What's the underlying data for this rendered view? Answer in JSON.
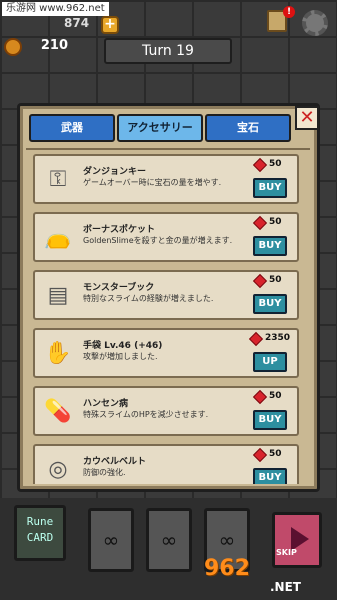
{
  "watermark": "乐游网 www.962.net",
  "header": {
    "hearts": "874",
    "coins": "210",
    "turn_label": "Turn 19"
  },
  "tabs": [
    {
      "label": "武器",
      "active": false
    },
    {
      "label": "アクセサリー",
      "active": true
    },
    {
      "label": "宝石",
      "active": false
    }
  ],
  "items": [
    {
      "name": "ダンジョンキー",
      "desc": "ゲームオーバー時に宝石の量を増やす.",
      "price": "50",
      "action": "BUY",
      "icon": "key-icon"
    },
    {
      "name": "ボーナスポケット",
      "desc": "GoldenSlimeを殺すと金の量が増えます.",
      "price": "50",
      "action": "BUY",
      "icon": "pouch-icon"
    },
    {
      "name": "モンスターブック",
      "desc": "特別なスライムの経験が増えました.",
      "price": "50",
      "action": "BUY",
      "icon": "book-icon"
    },
    {
      "name": "手袋 Lv.46 (+46)",
      "desc": "攻撃が増加しました.",
      "price": "2350",
      "action": "UP",
      "icon": "glove-icon"
    },
    {
      "name": "ハンセン病",
      "desc": "特殊スライムのHPを減少させます.",
      "price": "50",
      "action": "BUY",
      "icon": "pill-icon"
    },
    {
      "name": "カウベルベルト",
      "desc": "防御の強化.",
      "price": "50",
      "action": "BUY",
      "icon": "belt-icon"
    }
  ],
  "bottom": {
    "rune_card_line1": "Rune",
    "rune_card_line2": "CARD",
    "slot_glyphs": [
      "∞",
      "∞",
      "∞"
    ],
    "skip_label": "SKIP",
    "logo_text": "962",
    "logo_sub": ".NET"
  },
  "colors": {
    "tab_active": "#6db7ea",
    "tab_inactive": "#2f6fc4",
    "buy_button": "#2d8fa0",
    "gem": "#d8232c"
  }
}
